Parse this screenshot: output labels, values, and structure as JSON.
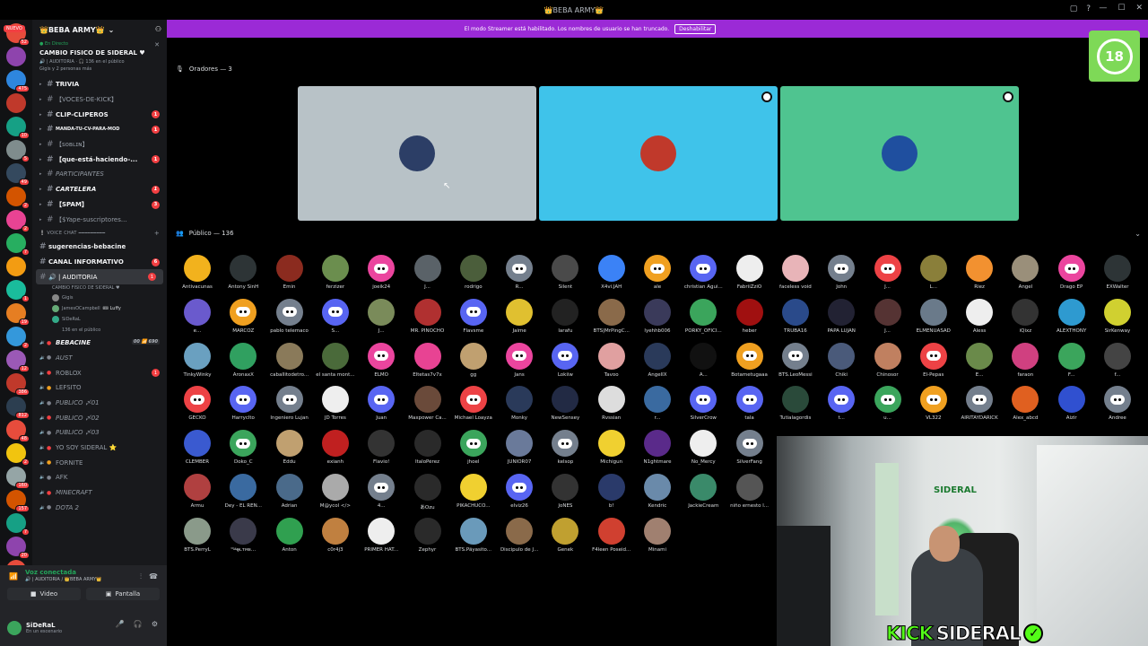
{
  "window": {
    "title": "👑BEBA ARMY👑"
  },
  "banner": {
    "text": "El modo Streamer está habilitado. Los nombres de usuario se han truncado.",
    "button": "Deshabilitar"
  },
  "rail": {
    "nuevo": "NUEVO",
    "servers": [
      {
        "color": "#e74c3c",
        "badge": "52"
      },
      {
        "color": "#8e44ad",
        "badge": ""
      },
      {
        "color": "#2e86de",
        "badge": "475"
      },
      {
        "color": "#c0392b",
        "badge": ""
      },
      {
        "color": "#16a085",
        "badge": "10"
      },
      {
        "color": "#7f8c8d",
        "badge": "5"
      },
      {
        "color": "#34495e",
        "badge": "49"
      },
      {
        "color": "#d35400",
        "badge": "2"
      },
      {
        "color": "#e84393",
        "badge": "2"
      },
      {
        "color": "#27ae60",
        "badge": "7"
      },
      {
        "color": "#f39c12",
        "badge": ""
      },
      {
        "color": "#1abc9c",
        "badge": "1"
      },
      {
        "color": "#e67e22",
        "badge": "19"
      },
      {
        "color": "#3498db",
        "badge": "2"
      },
      {
        "color": "#9b59b6",
        "badge": "12"
      },
      {
        "color": "#c0392b",
        "badge": "386"
      },
      {
        "color": "#2c3e50",
        "badge": "812"
      },
      {
        "color": "#e74c3c",
        "badge": "48"
      },
      {
        "color": "#f1c40f",
        "badge": "2"
      },
      {
        "color": "#95a5a6",
        "badge": "160"
      },
      {
        "color": "#d35400",
        "badge": "157"
      },
      {
        "color": "#16a085",
        "badge": "7"
      },
      {
        "color": "#8e44ad",
        "badge": "20"
      },
      {
        "color": "#e74c3c",
        "badge": "151"
      },
      {
        "color": "#27ae60",
        "badge": "144"
      }
    ]
  },
  "sidebar": {
    "server_name": "👑BEBA ARMY👑",
    "live": {
      "status": "● En Directo",
      "title": "CAMBIO FISICO DE SIDERAL ♥",
      "sub": "🔊 | AUDITORIA · 🎧 136 en el público",
      "sub2": "Gigis y 2 personas más"
    },
    "channels": [
      {
        "label": "TRIVIA",
        "type": "text",
        "style": "bold",
        "badge": ""
      },
      {
        "label": "【VOCES-DE-KICK】",
        "type": "text",
        "style": "",
        "badge": ""
      },
      {
        "label": "CLIP-CLIPEROS",
        "type": "text",
        "style": "bold",
        "badge": "1"
      },
      {
        "label": "MANDA-TU-CV-PARA-MOD",
        "type": "text",
        "style": "bold small",
        "badge": "1"
      },
      {
        "label": "【ꜱᴏʙʟɪɴ】",
        "type": "text",
        "style": "",
        "badge": ""
      },
      {
        "label": "【que-está-haciendo-...",
        "type": "text",
        "style": "bold",
        "badge": "1"
      },
      {
        "label": "PARTICIPANTES",
        "type": "text",
        "style": "italic",
        "badge": ""
      },
      {
        "label": "CARTELERA",
        "type": "text",
        "style": "bold italic",
        "badge": "1"
      },
      {
        "label": "【SPAM】",
        "type": "text",
        "style": "bold",
        "badge": "3"
      },
      {
        "label": "【$Yape-suscriptores...",
        "type": "text",
        "style": "",
        "badge": ""
      }
    ],
    "category_voice": "❕ VOICE CHAT ━━━━━━━━━",
    "voice_channels": [
      {
        "label": "sugerencias-bebacine",
        "style": "bold",
        "badge": ""
      },
      {
        "label": "CANAL INFORMATIVO",
        "style": "bold",
        "badge": "6"
      },
      {
        "label": "🔊 | AUDITORIA",
        "style": "selected",
        "badge": "1",
        "sub": "CAMBIO FISICO DE SIDERAL ♥"
      }
    ],
    "voice_users": [
      {
        "name": "Gigis",
        "tag": ""
      },
      {
        "name": "JamesOCampbell",
        "tag": "🎟 Luffy"
      },
      {
        "name": "SiDeRaL",
        "tag": ""
      },
      {
        "name": "136 en el público",
        "tag": ""
      }
    ],
    "more_channels": [
      {
        "label": "BEBACINE",
        "style": "bold italic",
        "badge2": "00 📶 690"
      },
      {
        "label": "AUST",
        "style": "italic",
        "badge": ""
      },
      {
        "label": "ROBLOX",
        "style": "",
        "badge": "1"
      },
      {
        "label": "LEFSITO",
        "style": "",
        "badge": ""
      },
      {
        "label": "PUBLICO 〆01",
        "style": "italic",
        "badge": ""
      },
      {
        "label": "PUBLICO 〆02",
        "style": "italic",
        "badge": ""
      },
      {
        "label": "PUBLICO 〆03",
        "style": "italic",
        "badge": ""
      },
      {
        "label": "YO SOY SIDERAL ⭐",
        "style": "",
        "badge": ""
      },
      {
        "label": "FORNITE",
        "style": "",
        "badge": ""
      },
      {
        "label": "AFK",
        "style": "",
        "badge": ""
      },
      {
        "label": "MINECRAFT",
        "style": "italic",
        "badge": ""
      },
      {
        "label": "DOTA 2",
        "style": "italic",
        "badge": ""
      }
    ]
  },
  "voice_panel": {
    "status": "Voz conectada",
    "sub": "🔊 | AUDITORIA / 👑BEBA ARMY👑",
    "video": "Video",
    "screen": "Pantalla"
  },
  "user_panel": {
    "name": "SiDeRaL",
    "status": "En un escenario"
  },
  "stage": {
    "speakers_label": "Oradores — 3",
    "audience_label": "Público — 136",
    "speakers": [
      {
        "bg": "#b8c2c7",
        "avatar": "#2c3e66"
      },
      {
        "bg": "#3fc3ea",
        "avatar": "#c0392b"
      },
      {
        "bg": "#4fc490",
        "avatar": "#1f4f9f"
      }
    ],
    "audience": [
      {
        "name": "Antivacunas",
        "c": "#f2b21d",
        "dc": false
      },
      {
        "name": "Antony SinH",
        "c": "#2d3436",
        "dc": false
      },
      {
        "name": "Emin",
        "c": "#8b2b1f",
        "dc": false
      },
      {
        "name": "ferzizer",
        "c": "#6b8e4e",
        "dc": false
      },
      {
        "name": "joeik24",
        "c": "#eb459e",
        "dc": true
      },
      {
        "name": "J...",
        "c": "#5a6268",
        "dc": false
      },
      {
        "name": "rodrigo",
        "c": "#4b5e3b",
        "dc": false
      },
      {
        "name": "R...",
        "c": "#747f8d",
        "dc": true
      },
      {
        "name": "Silent",
        "c": "#4a4a4a",
        "dc": false
      },
      {
        "name": "X4vi.JAH",
        "c": "#3b82f6",
        "dc": false
      },
      {
        "name": "ale",
        "c": "#f0a020",
        "dc": true
      },
      {
        "name": "christian Agui...",
        "c": "#5865f2",
        "dc": true
      },
      {
        "name": "FabriiZziO",
        "c": "#eeeeee",
        "dc": false
      },
      {
        "name": "faceless void",
        "c": "#e8b4b8",
        "dc": false
      },
      {
        "name": "John",
        "c": "#747f8d",
        "dc": true
      },
      {
        "name": "J...",
        "c": "#ed4245",
        "dc": true
      },
      {
        "name": "L...",
        "c": "#8a7f3a",
        "dc": false
      },
      {
        "name": "Riez",
        "c": "#f29130",
        "dc": false
      },
      {
        "name": "Angel",
        "c": "#9a8f7a",
        "dc": false
      },
      {
        "name": "Drago EP",
        "c": "#eb459e",
        "dc": true
      },
      {
        "name": "EXWalter",
        "c": "#2d3436",
        "dc": false
      },
      {
        "name": "e...",
        "c": "#6a5acd",
        "dc": false
      },
      {
        "name": "MARCOZ",
        "c": "#f0a020",
        "dc": true
      },
      {
        "name": "pablo telemaco",
        "c": "#747f8d",
        "dc": true
      },
      {
        "name": "S...",
        "c": "#5865f2",
        "dc": true
      },
      {
        "name": "J...",
        "c": "#7a8b5a",
        "dc": false
      },
      {
        "name": "MR. PINOCHO",
        "c": "#b03030",
        "dc": false
      },
      {
        "name": "Flavsme",
        "c": "#5865f2",
        "dc": true
      },
      {
        "name": "Jaime",
        "c": "#e0c030",
        "dc": false
      },
      {
        "name": "larafu",
        "c": "#222",
        "dc": false
      },
      {
        "name": "BTS|MrPingC...",
        "c": "#8a6a4a",
        "dc": false
      },
      {
        "name": "lyehhb006",
        "c": "#3a3a5a",
        "dc": false
      },
      {
        "name": "PORKY_OFICI...",
        "c": "#3ba55c",
        "dc": false
      },
      {
        "name": "heber",
        "c": "#a01010",
        "dc": false
      },
      {
        "name": "TRUBA16",
        "c": "#2a4a8a",
        "dc": false
      },
      {
        "name": "PAPA LUJAN",
        "c": "#223",
        "dc": false
      },
      {
        "name": "J...",
        "c": "#553333",
        "dc": false
      },
      {
        "name": "ELMENUASAD",
        "c": "#6a7a8a",
        "dc": false
      },
      {
        "name": "Aless",
        "c": "#eee",
        "dc": false
      },
      {
        "name": "iQixz",
        "c": "#333",
        "dc": false
      },
      {
        "name": "ALEXTHONY",
        "c": "#2e9ad0",
        "dc": false
      },
      {
        "name": "SirKenway",
        "c": "#d0d030",
        "dc": false
      },
      {
        "name": "TinkyWinky",
        "c": "#6aa0c0",
        "dc": false
      },
      {
        "name": "AronaxX",
        "c": "#30a060",
        "dc": false
      },
      {
        "name": "caballitodetro...",
        "c": "#8a7a5a",
        "dc": false
      },
      {
        "name": "el santa mont...",
        "c": "#4a6a3a",
        "dc": false
      },
      {
        "name": "ELMO",
        "c": "#eb459e",
        "dc": true
      },
      {
        "name": "Eltetas7v7x",
        "c": "#e84393",
        "dc": false
      },
      {
        "name": "gg",
        "c": "#c0a070",
        "dc": false
      },
      {
        "name": "Jans",
        "c": "#eb459e",
        "dc": true
      },
      {
        "name": "Lokiiw",
        "c": "#5865f2",
        "dc": true
      },
      {
        "name": "Tavoo",
        "c": "#e0a0a0",
        "dc": false
      },
      {
        "name": "AngelIX",
        "c": "#2a3a5a",
        "dc": false
      },
      {
        "name": "A...",
        "c": "#111",
        "dc": false
      },
      {
        "name": "Botametugaaa",
        "c": "#f0a020",
        "dc": true
      },
      {
        "name": "BTS.LeoMessi",
        "c": "#747f8d",
        "dc": true
      },
      {
        "name": "Chiki",
        "c": "#4a5a7a",
        "dc": false
      },
      {
        "name": "Chinosor",
        "c": "#c08060",
        "dc": false
      },
      {
        "name": "El-Pepas",
        "c": "#ed4245",
        "dc": true
      },
      {
        "name": "E...",
        "c": "#6a8a4a",
        "dc": false
      },
      {
        "name": "faraon",
        "c": "#d04080",
        "dc": false
      },
      {
        "name": "F...",
        "c": "#3ba55c",
        "dc": false
      },
      {
        "name": "f...",
        "c": "#444",
        "dc": false
      },
      {
        "name": "GECKO",
        "c": "#ed4245",
        "dc": true
      },
      {
        "name": "Harryclto",
        "c": "#5865f2",
        "dc": true
      },
      {
        "name": "Ingeniero Lujan",
        "c": "#747f8d",
        "dc": true
      },
      {
        "name": "JD Torres",
        "c": "#eee",
        "dc": false
      },
      {
        "name": "Juan",
        "c": "#5865f2",
        "dc": true
      },
      {
        "name": "Maxpower Ca...",
        "c": "#6a4a3a",
        "dc": false
      },
      {
        "name": "Michael Loayza",
        "c": "#ed4245",
        "dc": true
      },
      {
        "name": "Monky",
        "c": "#2a3a5a",
        "dc": false
      },
      {
        "name": "NewSensey",
        "c": "#222a44",
        "dc": false
      },
      {
        "name": "Rvssian",
        "c": "#ddd",
        "dc": false
      },
      {
        "name": "r...",
        "c": "#3a6aa0",
        "dc": false
      },
      {
        "name": "SilverCrow",
        "c": "#5865f2",
        "dc": true
      },
      {
        "name": "tala",
        "c": "#5865f2",
        "dc": true
      },
      {
        "name": "Tutialagordis",
        "c": "#2a4a3a",
        "dc": false
      },
      {
        "name": "t...",
        "c": "#5865f2",
        "dc": true
      },
      {
        "name": "u...",
        "c": "#3ba55c",
        "dc": true
      },
      {
        "name": "VL322",
        "c": "#f0a020",
        "dc": true
      },
      {
        "name": "AIRITAYDARICK",
        "c": "#747f8d",
        "dc": true
      },
      {
        "name": "Alex_abcd",
        "c": "#e06020",
        "dc": false
      },
      {
        "name": "Aizir",
        "c": "#3050d0",
        "dc": false
      },
      {
        "name": "Andree",
        "c": "#747f8d",
        "dc": true
      },
      {
        "name": "CLEMBER",
        "c": "#3a5ad0",
        "dc": false
      },
      {
        "name": "Doko_C",
        "c": "#3ba55c",
        "dc": true
      },
      {
        "name": "Eddu",
        "c": "#c0a070",
        "dc": false
      },
      {
        "name": "exianh",
        "c": "#c02020",
        "dc": false
      },
      {
        "name": "Flavio!",
        "c": "#333",
        "dc": false
      },
      {
        "name": "ItaloPérez",
        "c": "#2a2a2a",
        "dc": false
      },
      {
        "name": "jhoel",
        "c": "#3ba55c",
        "dc": true
      },
      {
        "name": "JUNIOR07",
        "c": "#6a7a9a",
        "dc": false
      },
      {
        "name": "kelsop",
        "c": "#747f8d",
        "dc": true
      },
      {
        "name": "Michigun",
        "c": "#f0d030",
        "dc": false
      },
      {
        "name": "N1ghtmare",
        "c": "#5a2a8a",
        "dc": false
      },
      {
        "name": "No_Mercy",
        "c": "#eee",
        "dc": false
      },
      {
        "name": "SilverFang",
        "c": "#747f8d",
        "dc": true
      },
      {
        "name": "Armu",
        "c": "#b04040",
        "dc": false
      },
      {
        "name": "Dey - EL REN...",
        "c": "#3a6aa0",
        "dc": false
      },
      {
        "name": "Adrian",
        "c": "#4a6a8a",
        "dc": false
      },
      {
        "name": "M@ycol </>",
        "c": "#aaa",
        "dc": false
      },
      {
        "name": "4...",
        "c": "#747f8d",
        "dc": true
      },
      {
        "name": "あOzu",
        "c": "#2a2a2a",
        "dc": false
      },
      {
        "name": "PIKACHUCO...",
        "c": "#f0d030",
        "dc": false
      },
      {
        "name": "elviz26",
        "c": "#5865f2",
        "dc": true
      },
      {
        "name": "JoNES",
        "c": "#333",
        "dc": false
      },
      {
        "name": "b!",
        "c": "#2a3a6a",
        "dc": false
      },
      {
        "name": "Kendric",
        "c": "#6a8aaa",
        "dc": false
      },
      {
        "name": "JackieCream",
        "c": "#3a8a6a",
        "dc": false
      },
      {
        "name": "niño ernesto l...",
        "c": "#555",
        "dc": false
      },
      {
        "name": "BTS.PerryL",
        "c": "#8a9a8a",
        "dc": false
      },
      {
        "name": "ᵗʰᵉ̶̶ǫ̶ʟᴛᴍᴇ...",
        "c": "#3a3a4a",
        "dc": false
      },
      {
        "name": "Anton",
        "c": "#30a050",
        "dc": false
      },
      {
        "name": "c0r4j3",
        "c": "#c08040",
        "dc": false
      },
      {
        "name": "PRIMER HAT...",
        "c": "#eee",
        "dc": false
      },
      {
        "name": "Zephyr",
        "c": "#2a2a2a",
        "dc": false
      },
      {
        "name": "BTS.Päyasito...",
        "c": "#6a9aba",
        "dc": false
      },
      {
        "name": "Discipulo de J...",
        "c": "#8a6a4a",
        "dc": false
      },
      {
        "name": "Genek",
        "c": "#c0a030",
        "dc": false
      },
      {
        "name": "F4leen Poseid...",
        "c": "#d04030",
        "dc": false
      },
      {
        "name": "Minami",
        "c": "#a08070",
        "dc": false
      }
    ]
  },
  "overlay": {
    "age": "18",
    "kick_a": "KICK",
    "kick_b": "SIDERAL",
    "webcam_logo": "SIDERAL"
  }
}
